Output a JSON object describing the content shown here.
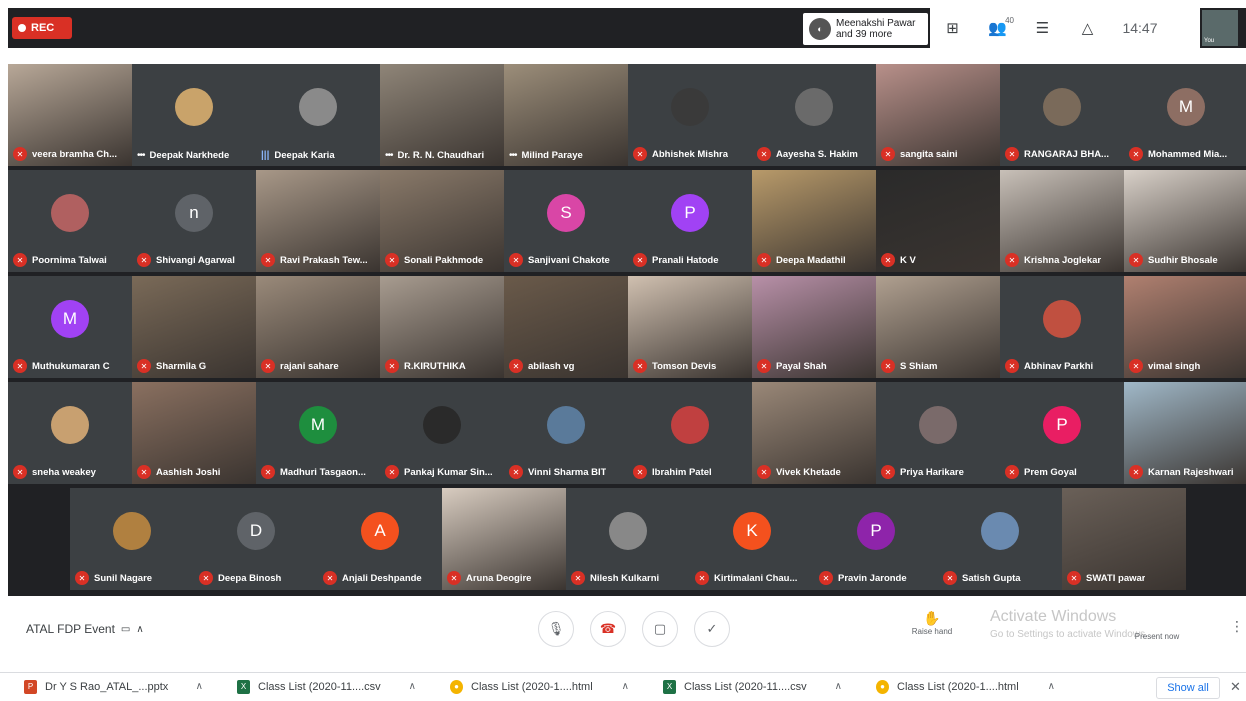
{
  "topbar": {
    "rec_label": "REC",
    "presenter_line1": "Meenakshi Pawar",
    "presenter_line2": "and 39 more",
    "people_count": "40",
    "clock": "14:47",
    "self_label": "You"
  },
  "tiles_row1": [
    {
      "name": "veera bramha Ch...",
      "state": "muted",
      "type": "video",
      "color": "#b8a898"
    },
    {
      "name": "Deepak Narkhede",
      "state": "dots",
      "type": "avatar",
      "color": "#c9a36a"
    },
    {
      "name": "Deepak Karia",
      "state": "speaking",
      "type": "avatar",
      "color": "#8a8a8a"
    },
    {
      "name": "Dr. R. N. Chaudhari",
      "state": "dots",
      "type": "video",
      "color": "#8f8578"
    },
    {
      "name": "Milind Paraye",
      "state": "dots",
      "type": "video",
      "color": "#9c8e7a"
    },
    {
      "name": "Abhishek Mishra",
      "state": "muted",
      "type": "avatar",
      "color": "#3a3a3a"
    },
    {
      "name": "Aayesha S. Hakim",
      "state": "muted",
      "type": "avatar",
      "color": "#6a6a6a"
    },
    {
      "name": "sangita saini",
      "state": "muted",
      "type": "video",
      "color": "#b8908a"
    },
    {
      "name": "RANGARAJ BHA...",
      "state": "muted",
      "type": "avatar",
      "color": "#7a6a5a"
    },
    {
      "name": "Mohammed Mia...",
      "state": "muted",
      "type": "letter",
      "letter": "M",
      "color": "#8d6e63"
    }
  ],
  "tiles_row2": [
    {
      "name": "Poornima Talwai",
      "state": "muted",
      "type": "avatar",
      "color": "#b06060"
    },
    {
      "name": "Shivangi Agarwal",
      "state": "muted",
      "type": "letter",
      "letter": "n",
      "color": "#5f6368"
    },
    {
      "name": "Ravi Prakash Tew...",
      "state": "muted",
      "type": "video",
      "color": "#a89888"
    },
    {
      "name": "Sonali Pakhmode",
      "state": "muted",
      "type": "video",
      "color": "#8a7a6a"
    },
    {
      "name": "Sanjivani Chakote",
      "state": "muted",
      "type": "letter",
      "letter": "S",
      "color": "#d946a6"
    },
    {
      "name": "Pranali Hatode",
      "state": "muted",
      "type": "letter",
      "letter": "P",
      "color": "#a142f4"
    },
    {
      "name": "Deepa Madathil",
      "state": "muted",
      "type": "video",
      "color": "#b89a6a"
    },
    {
      "name": "K V",
      "state": "muted",
      "type": "video",
      "color": "#2a2a2a"
    },
    {
      "name": "Krishna Joglekar",
      "state": "muted",
      "type": "video",
      "color": "#c8c0b8"
    },
    {
      "name": "Sudhir Bhosale",
      "state": "muted",
      "type": "video",
      "color": "#d8d0c8"
    }
  ],
  "tiles_row3": [
    {
      "name": "Muthukumaran C",
      "state": "muted",
      "type": "letter",
      "letter": "M",
      "color": "#a142f4"
    },
    {
      "name": "Sharmila G",
      "state": "muted",
      "type": "video",
      "color": "#7a6a58"
    },
    {
      "name": "rajani sahare",
      "state": "muted",
      "type": "video",
      "color": "#9a8a7a"
    },
    {
      "name": "R.KIRUTHIKA",
      "state": "muted",
      "type": "video",
      "color": "#a89c90"
    },
    {
      "name": "abilash vg",
      "state": "muted",
      "type": "video",
      "color": "#6a5a4a"
    },
    {
      "name": "Tomson Devis",
      "state": "muted",
      "type": "video",
      "color": "#d0c0b0"
    },
    {
      "name": "Payal Shah",
      "state": "muted",
      "type": "video",
      "color": "#b890a8"
    },
    {
      "name": "S Shiam",
      "state": "muted",
      "type": "video",
      "color": "#b0a090"
    },
    {
      "name": "Abhinav Parkhi",
      "state": "muted",
      "type": "avatar",
      "color": "#c05040"
    },
    {
      "name": "vimal singh",
      "state": "muted",
      "type": "video",
      "color": "#b08070"
    }
  ],
  "tiles_row4": [
    {
      "name": "sneha weakey",
      "state": "muted",
      "type": "avatar",
      "color": "#c8a070"
    },
    {
      "name": "Aashish Joshi",
      "state": "muted",
      "type": "video",
      "color": "#8a7060"
    },
    {
      "name": "Madhuri Tasgaon...",
      "state": "muted",
      "type": "letter",
      "letter": "M",
      "color": "#1e8e3e"
    },
    {
      "name": "Pankaj Kumar Sin...",
      "state": "muted",
      "type": "avatar",
      "color": "#2a2a2a"
    },
    {
      "name": "Vinni Sharma BIT",
      "state": "muted",
      "type": "avatar",
      "color": "#5a7a9a"
    },
    {
      "name": "Ibrahim Patel",
      "state": "muted",
      "type": "avatar",
      "color": "#c04040"
    },
    {
      "name": "Vivek Khetade",
      "state": "muted",
      "type": "video",
      "color": "#9a8878"
    },
    {
      "name": "Priya Harikare",
      "state": "muted",
      "type": "avatar",
      "color": "#7a6a6a"
    },
    {
      "name": "Prem Goyal",
      "state": "muted",
      "type": "letter",
      "letter": "P",
      "color": "#e91e63"
    },
    {
      "name": "Karnan Rajeshwari",
      "state": "muted",
      "type": "video",
      "color": "#a0b8c8"
    }
  ],
  "tiles_row5": [
    {
      "name": "Sunil Nagare",
      "state": "muted",
      "type": "avatar",
      "color": "#b08040"
    },
    {
      "name": "Deepa Binosh",
      "state": "muted",
      "type": "letter",
      "letter": "D",
      "color": "#5f6368"
    },
    {
      "name": "Anjali Deshpande",
      "state": "muted",
      "type": "letter",
      "letter": "A",
      "color": "#f4511e"
    },
    {
      "name": "Aruna Deogire",
      "state": "muted",
      "type": "video",
      "color": "#d8ccc0"
    },
    {
      "name": "Nilesh Kulkarni",
      "state": "muted",
      "type": "avatar",
      "color": "#888888"
    },
    {
      "name": "Kirtimalani Chau...",
      "state": "muted",
      "type": "letter",
      "letter": "K",
      "color": "#f4511e"
    },
    {
      "name": "Pravin Jaronde",
      "state": "muted",
      "type": "letter",
      "letter": "P",
      "color": "#8e24aa"
    },
    {
      "name": "Satish Gupta",
      "state": "muted",
      "type": "avatar",
      "color": "#6a8ab0"
    },
    {
      "name": "SWATI pawar",
      "state": "muted",
      "type": "video",
      "color": "#6a6058"
    }
  ],
  "bottombar": {
    "meeting_title": "ATAL FDP Event",
    "raise_hand": "Raise hand",
    "captions": "Turn on captions",
    "present": "Present now",
    "activate_line1": "Activate Windows",
    "activate_line2": "Go to Settings to activate Windows."
  },
  "downloads": [
    {
      "label": "Dr Y S Rao_ATAL_...pptx",
      "icon": "ppt",
      "color": "#d24726"
    },
    {
      "label": "Class List (2020-11....csv",
      "icon": "xls",
      "color": "#1e7145"
    },
    {
      "label": "Class List (2020-1....html",
      "icon": "chrome",
      "color": "#f4b400"
    },
    {
      "label": "Class List (2020-11....csv",
      "icon": "xls",
      "color": "#1e7145"
    },
    {
      "label": "Class List (2020-1....html",
      "icon": "chrome",
      "color": "#f4b400"
    }
  ],
  "show_all_label": "Show all"
}
